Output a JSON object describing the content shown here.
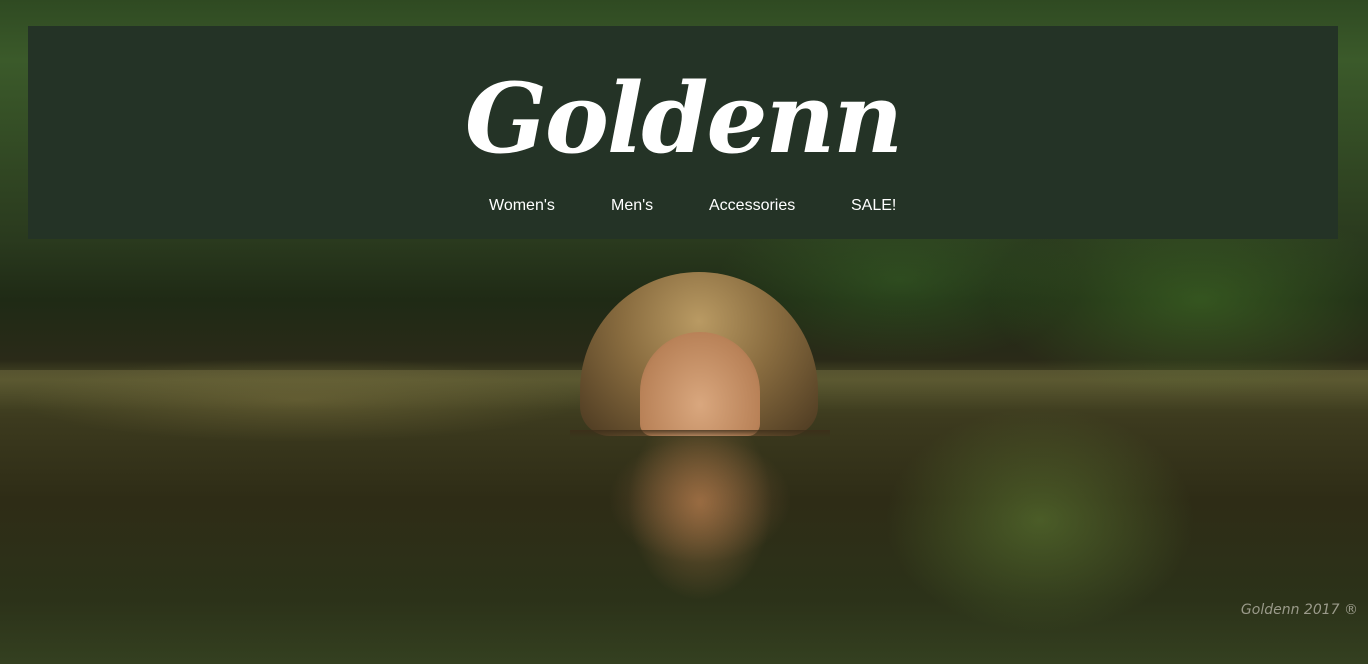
{
  "brand": {
    "logo_text": "Goldenn"
  },
  "nav": {
    "items": [
      {
        "label": "Women's"
      },
      {
        "label": "Men's"
      },
      {
        "label": "Accessories"
      },
      {
        "label": "SALE!"
      }
    ]
  },
  "hero": {
    "image_description": "person swimming in forest river"
  },
  "footer": {
    "copyright": "Goldenn 2017 ®"
  },
  "colors": {
    "header_background": "#243326",
    "nav_text": "#ffffff",
    "copyright_text": "#9a9a8a"
  }
}
